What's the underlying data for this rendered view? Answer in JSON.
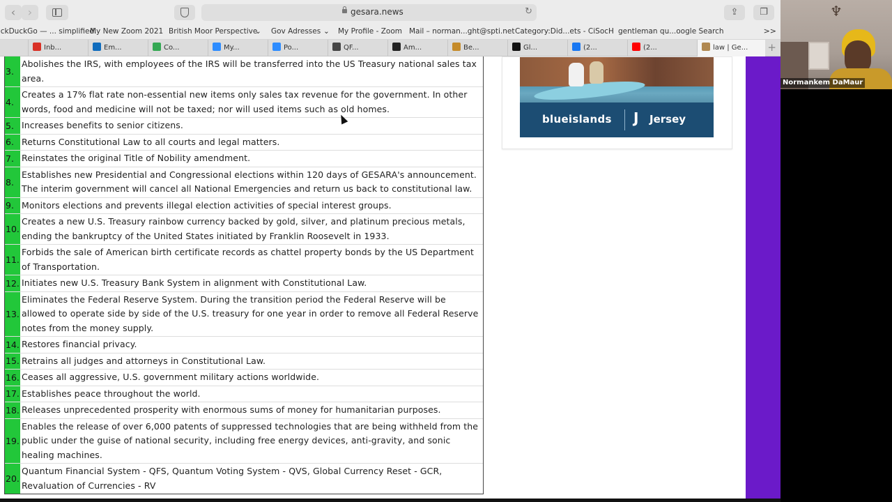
{
  "browser": {
    "url": "gesara.news",
    "bookmarks": [
      "DuckDuckGo — ... simplified.",
      "My New Zoom 2021",
      "British Moor Perspective",
      "Gov Adresses",
      "My Profile - Zoom",
      "Mail – norman...ght@spti.net",
      "Category:Did...ets - CiSocH",
      "gentleman qu...oogle Search"
    ],
    "tabs": [
      {
        "label": "Inb...",
        "color": "#d93025"
      },
      {
        "label": "Em...",
        "color": "#0f6cbd"
      },
      {
        "label": "Co...",
        "color": "#34a853"
      },
      {
        "label": "My...",
        "color": "#2d8cff"
      },
      {
        "label": "Po...",
        "color": "#2d8cff"
      },
      {
        "label": "QF...",
        "color": "#444444"
      },
      {
        "label": "Am...",
        "color": "#222222"
      },
      {
        "label": "Be...",
        "color": "#c58b2a"
      },
      {
        "label": "Gl...",
        "color": "#111111"
      },
      {
        "label": "(2...",
        "color": "#1877f2"
      },
      {
        "label": "(2...",
        "color": "#ff0000"
      },
      {
        "label": "law | Ge...",
        "color": "#b08850"
      }
    ]
  },
  "list": [
    {
      "num": "3.",
      "text": "Abolishes the IRS, with employees of the IRS will be transferred into the US Treasury national sales tax area."
    },
    {
      "num": "4.",
      "text": "Creates a 17% flat rate non-essential new items only sales tax revenue for the government. In other words, food and medicine will not be taxed; nor will used items such as old homes."
    },
    {
      "num": "5.",
      "text": "Increases benefits to senior citizens."
    },
    {
      "num": "6.",
      "text": "Returns Constitutional Law to all courts and legal matters."
    },
    {
      "num": "7.",
      "text": "Reinstates the original Title of Nobility amendment."
    },
    {
      "num": "8.",
      "text": "Establishes new Presidential and Congressional elections within 120 days of GESARA's announcement. The interim government will cancel all National Emergencies and return us back to constitutional law."
    },
    {
      "num": "9.",
      "text": "Monitors elections and prevents illegal election activities of special interest groups."
    },
    {
      "num": "10.",
      "text": "Creates a new U.S. Treasury rainbow currency backed by gold, silver, and platinum precious metals, ending the bankruptcy of the United States initiated by Franklin Roosevelt in 1933."
    },
    {
      "num": "11.",
      "text": "Forbids the sale of American birth certificate records as chattel property bonds by the US Department of Transportation."
    },
    {
      "num": "12.",
      "text": "Initiates new U.S. Treasury Bank System in alignment with Constitutional Law."
    },
    {
      "num": "13.",
      "text": "Eliminates the Federal Reserve System. During the transition period the Federal Reserve will be allowed to operate side by side of the U.S. treasury for one year in order to remove all Federal Reserve notes from the money supply."
    },
    {
      "num": "14.",
      "text": "Restores financial privacy."
    },
    {
      "num": "15.",
      "text": "Retrains all judges and attorneys in Constitutional Law."
    },
    {
      "num": "16.",
      "text": "Ceases all aggressive, U.S. government military actions worldwide."
    },
    {
      "num": "17.",
      "text": "Establishes peace throughout the world."
    },
    {
      "num": "18.",
      "text": "Releases unprecedented prosperity with enormous sums of money for humanitarian purposes."
    },
    {
      "num": "19.",
      "text": "Enables the release of over 6,000 patents of suppressed technologies that are being withheld from the public under the guise of national security, including free energy devices, anti-gravity, and sonic healing machines."
    },
    {
      "num": "20.",
      "text": "Quantum Financial System - QFS, Quantum Voting System - QVS, Global Currency Reset - GCR, Revaluation of Currencies - RV"
    }
  ],
  "ad": {
    "brand1": "blueislands",
    "brand2": "Jersey"
  },
  "video": {
    "participant_name": "Normankem DaMaur"
  },
  "colors": {
    "number_cell": "#22c73a",
    "sidebar_strip": "#6b1ac9"
  }
}
